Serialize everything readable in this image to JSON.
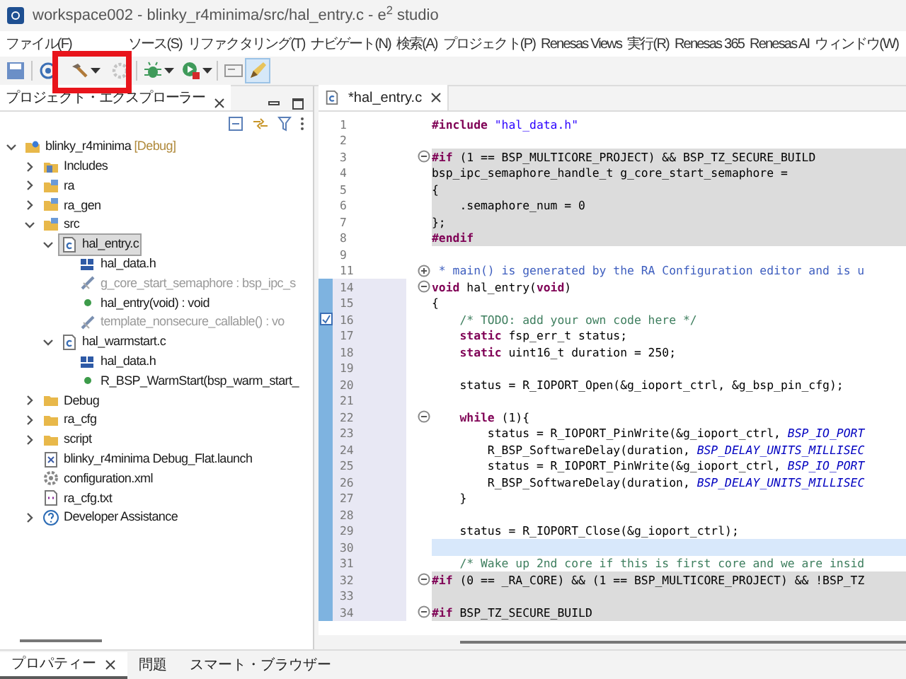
{
  "window": {
    "title": "workspace002 - blinky_r4minima/src/hal_entry.c - e$^{2}$ studio"
  },
  "menu": [
    {
      "label": "ファイル(F)"
    },
    {
      "label": "ソース(S)"
    },
    {
      "label": "リファクタリング(T)"
    },
    {
      "label": "ナビゲート(N)"
    },
    {
      "label": "検索(A)"
    },
    {
      "label": "プロジェクト(P)"
    },
    {
      "label": "Renesas Views"
    },
    {
      "label": "実行(R)"
    },
    {
      "label": "Renesas 365"
    },
    {
      "label": "Renesas AI"
    },
    {
      "label": "ウィンドウ(W)"
    }
  ],
  "explorer": {
    "title": "プロジェクト・エクスプローラー",
    "tree": [
      {
        "label": "blinky_r4minima",
        "suffix": "[Debug]",
        "kind": "project",
        "expanded": true,
        "selected": false,
        "dim": false,
        "children": [
          {
            "label": "Includes",
            "kind": "includes",
            "expanded": false,
            "selected": false,
            "dim": false
          },
          {
            "label": "ra",
            "kind": "srcfolder",
            "expanded": false,
            "selected": false,
            "dim": false
          },
          {
            "label": "ra_gen",
            "kind": "srcfolder",
            "expanded": false,
            "selected": false,
            "dim": false
          },
          {
            "label": "src",
            "kind": "srcfolder",
            "expanded": true,
            "selected": false,
            "dim": false,
            "children": [
              {
                "label": "hal_entry.c",
                "kind": "cfile",
                "expanded": true,
                "selected": true,
                "dim": false,
                "children": [
                  {
                    "label": "hal_data.h",
                    "kind": "header",
                    "selected": false,
                    "dim": false
                  },
                  {
                    "label": "g_core_start_semaphore : bsp_ipc_s",
                    "kind": "variable",
                    "selected": false,
                    "dim": true
                  },
                  {
                    "label": "hal_entry(void) : void",
                    "kind": "function",
                    "selected": false,
                    "dim": false
                  },
                  {
                    "label": "template_nonsecure_callable() : vo",
                    "kind": "variable",
                    "selected": false,
                    "dim": true
                  }
                ]
              },
              {
                "label": "hal_warmstart.c",
                "kind": "cfile",
                "expanded": true,
                "selected": false,
                "dim": false,
                "children": [
                  {
                    "label": "hal_data.h",
                    "kind": "header",
                    "selected": false,
                    "dim": false
                  },
                  {
                    "label": "R_BSP_WarmStart(bsp_warm_start_",
                    "kind": "function",
                    "selected": false,
                    "dim": false
                  }
                ]
              }
            ]
          },
          {
            "label": "Debug",
            "kind": "folder",
            "expanded": false,
            "selected": false,
            "dim": false
          },
          {
            "label": "ra_cfg",
            "kind": "folder",
            "expanded": false,
            "selected": false,
            "dim": false
          },
          {
            "label": "script",
            "kind": "folder",
            "expanded": false,
            "selected": false,
            "dim": false
          },
          {
            "label": "blinky_r4minima Debug_Flat.launch",
            "kind": "launch",
            "selected": false,
            "dim": false
          },
          {
            "label": "configuration.xml",
            "kind": "gear",
            "selected": false,
            "dim": false
          },
          {
            "label": "ra_cfg.txt",
            "kind": "text",
            "selected": false,
            "dim": false
          },
          {
            "label": "Developer Assistance",
            "kind": "help",
            "expanded": false,
            "selected": false,
            "dim": false
          }
        ]
      }
    ]
  },
  "editor": {
    "tab": "*hal_entry.c",
    "lines": [
      {
        "n": "1",
        "shaded": false,
        "changed": false,
        "current": false,
        "tokens": [
          {
            "kind": "pre",
            "text": "#include"
          },
          {
            "kind": "string",
            "text": " \"hal_data.h\""
          }
        ]
      },
      {
        "n": "2",
        "shaded": false,
        "changed": false,
        "current": false
      },
      {
        "n": "3",
        "collapsed": false,
        "shaded": true,
        "changed": false,
        "current": false,
        "tokens": [
          {
            "kind": "pre",
            "text": "#if"
          },
          {
            "kind": "plain",
            "text": " (1 == BSP_MULTICORE_PROJECT) && BSP_TZ_SECURE_BUILD"
          }
        ]
      },
      {
        "n": "4",
        "shaded": true,
        "changed": false,
        "current": false,
        "tokens": [
          {
            "kind": "plain",
            "text": "bsp_ipc_semaphore_handle_t g_core_start_semaphore ="
          }
        ]
      },
      {
        "n": "5",
        "shaded": true,
        "changed": false,
        "current": false,
        "tokens": [
          {
            "kind": "plain",
            "text": "{"
          }
        ]
      },
      {
        "n": "6",
        "shaded": true,
        "changed": false,
        "current": false,
        "tokens": [
          {
            "kind": "plain",
            "text": "    .semaphore_num = 0"
          }
        ]
      },
      {
        "n": "7",
        "shaded": true,
        "changed": false,
        "current": false,
        "tokens": [
          {
            "kind": "plain",
            "text": "};"
          }
        ]
      },
      {
        "n": "8",
        "shaded": true,
        "changed": false,
        "current": false,
        "tokens": [
          {
            "kind": "pre",
            "text": "#endif"
          }
        ]
      },
      {
        "n": "9",
        "shaded": false,
        "changed": false,
        "current": false
      },
      {
        "n": "11",
        "collapsed": true,
        "shaded": false,
        "changed": false,
        "current": false,
        "tokens": [
          {
            "kind": "doc",
            "text": " * main() is generated by the RA Configuration editor and is u"
          }
        ]
      },
      {
        "n": "14",
        "collapsed": false,
        "shaded": false,
        "changed": true,
        "current": false,
        "tokens": [
          {
            "kind": "keyword",
            "text": "void"
          },
          {
            "kind": "plain",
            "text": " hal_entry("
          },
          {
            "kind": "keyword",
            "text": "void"
          },
          {
            "kind": "plain",
            "text": ")"
          }
        ]
      },
      {
        "n": "15",
        "shaded": false,
        "changed": true,
        "current": false,
        "tokens": [
          {
            "kind": "plain",
            "text": "{"
          }
        ]
      },
      {
        "n": "16",
        "shaded": false,
        "changed": true,
        "current": false,
        "task": true,
        "tokens": [
          {
            "kind": "comment",
            "text": "    /* TODO: add your own code here */"
          }
        ]
      },
      {
        "n": "17",
        "shaded": false,
        "changed": true,
        "current": false,
        "tokens": [
          {
            "kind": "keyword",
            "text": "    static"
          },
          {
            "kind": "plain",
            "text": " fsp_err_t status;"
          }
        ]
      },
      {
        "n": "18",
        "shaded": false,
        "changed": true,
        "current": false,
        "tokens": [
          {
            "kind": "keyword",
            "text": "    static"
          },
          {
            "kind": "plain",
            "text": " uint16_t duration = 250;"
          }
        ]
      },
      {
        "n": "19",
        "shaded": false,
        "changed": true,
        "current": false
      },
      {
        "n": "20",
        "shaded": false,
        "changed": true,
        "current": false,
        "tokens": [
          {
            "kind": "plain",
            "text": "    status = R_IOPORT_Open(&g_ioport_ctrl, &g_bsp_pin_cfg);"
          }
        ]
      },
      {
        "n": "21",
        "shaded": false,
        "changed": true,
        "current": false
      },
      {
        "n": "22",
        "collapsed": false,
        "shaded": false,
        "changed": true,
        "current": false,
        "tokens": [
          {
            "kind": "keyword",
            "text": "    while"
          },
          {
            "kind": "plain",
            "text": " (1){"
          }
        ]
      },
      {
        "n": "23",
        "shaded": false,
        "changed": true,
        "current": false,
        "tokens": [
          {
            "kind": "plain",
            "text": "        status = R_IOPORT_PinWrite(&g_ioport_ctrl, "
          },
          {
            "kind": "macro",
            "text": "BSP_IO_PORT"
          }
        ]
      },
      {
        "n": "24",
        "shaded": false,
        "changed": true,
        "current": false,
        "tokens": [
          {
            "kind": "plain",
            "text": "        R_BSP_SoftwareDelay(duration, "
          },
          {
            "kind": "macro",
            "text": "BSP_DELAY_UNITS_MILLISEC"
          }
        ]
      },
      {
        "n": "25",
        "shaded": false,
        "changed": true,
        "current": false,
        "tokens": [
          {
            "kind": "plain",
            "text": "        status = R_IOPORT_PinWrite(&g_ioport_ctrl, "
          },
          {
            "kind": "macro",
            "text": "BSP_IO_PORT"
          }
        ]
      },
      {
        "n": "26",
        "shaded": false,
        "changed": true,
        "current": false,
        "tokens": [
          {
            "kind": "plain",
            "text": "        R_BSP_SoftwareDelay(duration, "
          },
          {
            "kind": "macro",
            "text": "BSP_DELAY_UNITS_MILLISEC"
          }
        ]
      },
      {
        "n": "27",
        "shaded": false,
        "changed": true,
        "current": false,
        "tokens": [
          {
            "kind": "plain",
            "text": "    }"
          }
        ]
      },
      {
        "n": "28",
        "shaded": false,
        "changed": true,
        "current": false
      },
      {
        "n": "29",
        "shaded": false,
        "changed": true,
        "current": false,
        "tokens": [
          {
            "kind": "plain",
            "text": "    status = R_IOPORT_Close(&g_ioport_ctrl);"
          }
        ]
      },
      {
        "n": "30",
        "shaded": false,
        "changed": true,
        "current": true
      },
      {
        "n": "31",
        "shaded": false,
        "changed": true,
        "current": false,
        "tokens": [
          {
            "kind": "comment",
            "text": "    /* Wake up 2nd core if this is first core and we are insid"
          }
        ]
      },
      {
        "n": "32",
        "collapsed": false,
        "shaded": true,
        "changed": true,
        "current": false,
        "tokens": [
          {
            "kind": "pre",
            "text": "#if"
          },
          {
            "kind": "plain",
            "text": " (0 == _RA_CORE) && (1 == BSP_MULTICORE_PROJECT) && !BSP_TZ"
          }
        ]
      },
      {
        "n": "33",
        "shaded": true,
        "changed": true,
        "current": false
      },
      {
        "n": "34",
        "collapsed": false,
        "shaded": true,
        "changed": true,
        "current": false,
        "tokens": [
          {
            "kind": "pre",
            "text": "#if"
          },
          {
            "kind": "plain",
            "text": " BSP_TZ_SECURE_BUILD"
          }
        ]
      }
    ]
  },
  "bottom_tabs": [
    {
      "label": "プロパティー",
      "selected": true,
      "closable": true
    },
    {
      "label": "問題",
      "selected": false,
      "closable": false
    },
    {
      "label": "スマート・ブラウザー",
      "selected": false,
      "closable": false
    }
  ]
}
